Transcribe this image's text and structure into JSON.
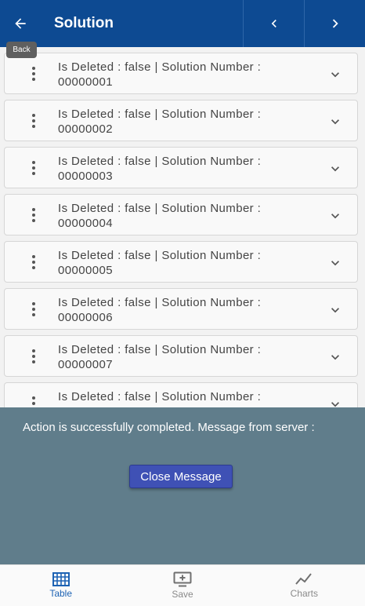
{
  "header": {
    "title": "Solution",
    "back_tooltip": "Back"
  },
  "rows": [
    {
      "text": "Is Deleted  : false | Solution Number  : 00000001"
    },
    {
      "text": "Is Deleted  : false | Solution Number  : 00000002"
    },
    {
      "text": "Is Deleted  : false | Solution Number  : 00000003"
    },
    {
      "text": "Is Deleted  : false | Solution Number  : 00000004"
    },
    {
      "text": "Is Deleted  : false | Solution Number  : 00000005"
    },
    {
      "text": "Is Deleted  : false | Solution Number  : 00000006"
    },
    {
      "text": "Is Deleted  : false | Solution Number  : 00000007"
    },
    {
      "text": "Is Deleted  : false | Solution Number  :"
    }
  ],
  "message": {
    "text": " Action is successfully completed. Message from server :",
    "close_label": "Close Message"
  },
  "bottom_nav": {
    "table": "Table",
    "save": "Save",
    "charts": "Charts"
  },
  "colors": {
    "header": "#0d4a92",
    "panel": "#607d8b",
    "button": "#3f51b5",
    "active": "#1d63b4"
  }
}
